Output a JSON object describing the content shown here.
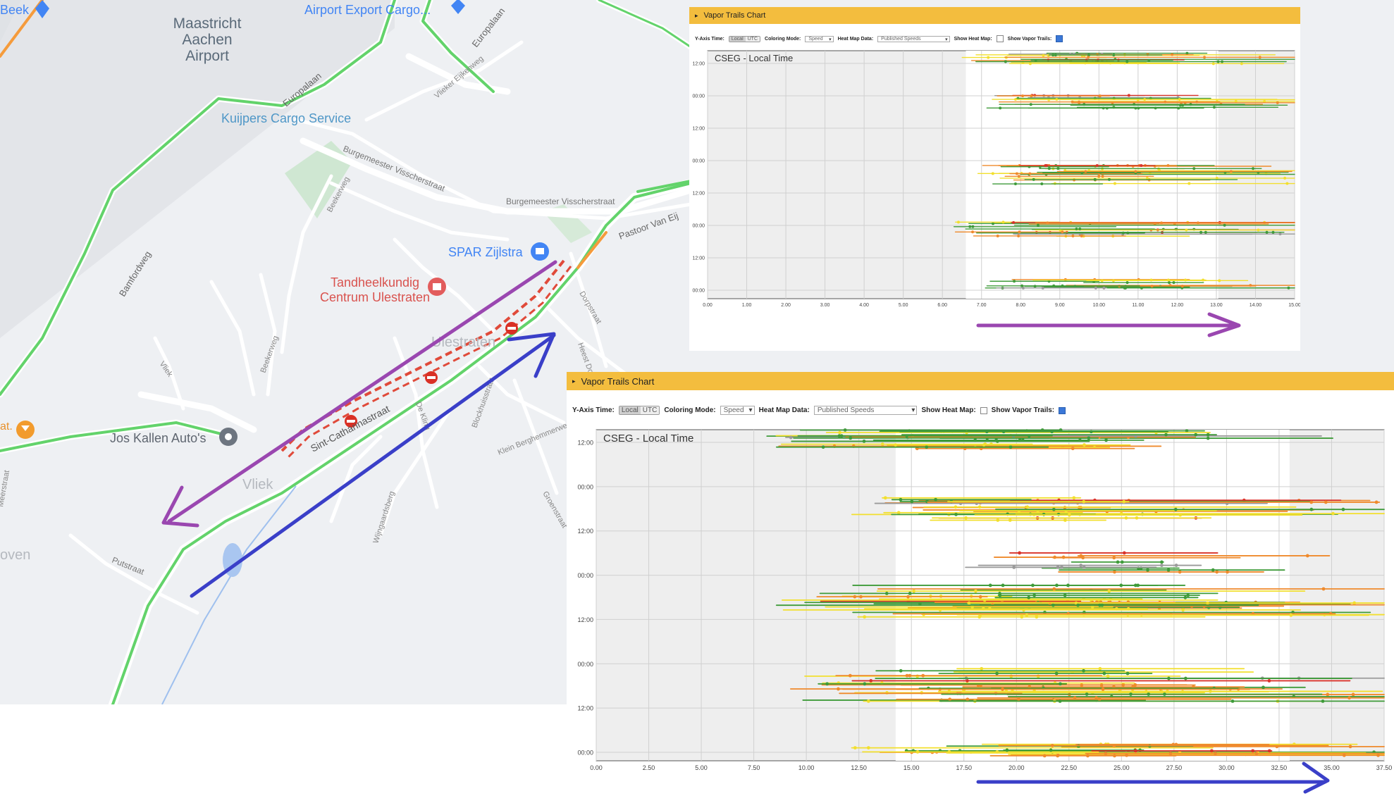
{
  "map": {
    "places": {
      "beek": "Beek",
      "airport": "Maastricht\nAachen\nAirport",
      "airport_export": "Airport Export Cargo...",
      "kuijpers": "Kuijpers Cargo Service",
      "spar": "SPAR Zijlstra",
      "tandheel": "Tandheelkundig\nCentrum Ulestraten",
      "ulestraten": "Ulestraten",
      "jos_kallen": "Jos Kallen Auto's",
      "vliek": "Vliek",
      "oven": "oven",
      "at": "at."
    },
    "roads": {
      "europalaan": "Europalaan",
      "europalaan_2": "Europalaan",
      "vliekerweg": "Vlieker Eijkenweg",
      "burgemeester1": "Burgemeester Visscherstraat",
      "burgemeester2": "Burgemeester Visscherstraat",
      "beekerweg": "Beekerweg",
      "bamfordweg": "Bamfordweg",
      "pastoor": "Pastoor Van Eij",
      "sint_catharinastraat": "Sint-Catharinastraat",
      "dorpstraat": "Dorpstraat",
      "putstraat": "Putstraat",
      "vliek_road": "Vliek",
      "beekerweg2": "Beekerweg",
      "de_kling": "De Kling",
      "blockhuisstraat": "Blockhuisstraat",
      "klein_berghemmerweg": "Klein Berghemmerweg",
      "wijngaardsberg": "Wijngaardsberg",
      "groenstraat": "Groenstraat",
      "meerstraat": "Meerstraat",
      "hessel": "Heest Do"
    },
    "colors": {
      "land": "#eef0f3",
      "airport_area": "#e3e5e9",
      "road_green": "#63d36b",
      "road_orange": "#f59b3c",
      "road_red": "#e04a3a",
      "purple_arrow": "#9a47b0",
      "blue_arrow": "#3a3fc8"
    }
  },
  "charts": [
    {
      "title": "Vapor Trails Chart",
      "controls": {
        "y_axis_time_label": "Y-Axis Time:",
        "y_axis_options": [
          "Local",
          "UTC"
        ],
        "coloring_mode_label": "Coloring Mode:",
        "coloring_mode_value": "Speed",
        "heat_map_label": "Heat Map Data:",
        "heat_map_value": "Published Speeds",
        "show_heat_map_label": "Show Heat Map:",
        "show_heat_map_checked": false,
        "show_vapor_trails_label": "Show Vapor Trails:",
        "show_vapor_trails_checked": true
      },
      "chart_data": {
        "type": "scatter",
        "title": "CSEG - Local Time",
        "y_tick_labels": [
          "12:00",
          "00:00",
          "12:00",
          "00:00",
          "12:00",
          "00:00",
          "12:00",
          "00:00"
        ],
        "x_tick_labels": [
          "0.00",
          "1.00",
          "2.00",
          "3.00",
          "4.00",
          "5.00",
          "6.00",
          "7.00",
          "8.00",
          "9.00",
          "10.00",
          "11.00",
          "12.00",
          "13.00",
          "14.00",
          "15.00"
        ],
        "x_range": [
          0,
          15
        ],
        "grid": true,
        "colors": {
          "green": "#3f9b3a",
          "yellow": "#f2df2e",
          "orange": "#ef8a2c",
          "red": "#d9342b",
          "gray": "#9a9a9a"
        }
      }
    },
    {
      "title": "Vapor Trails Chart",
      "controls": {
        "y_axis_time_label": "Y-Axis Time:",
        "y_axis_options": [
          "Local",
          "UTC"
        ],
        "coloring_mode_label": "Coloring Mode:",
        "coloring_mode_value": "Speed",
        "heat_map_label": "Heat Map Data:",
        "heat_map_value": "Published Speeds",
        "show_heat_map_label": "Show Heat Map:",
        "show_heat_map_checked": false,
        "show_vapor_trails_label": "Show Vapor Trails:",
        "show_vapor_trails_checked": true
      },
      "chart_data": {
        "type": "scatter",
        "title": "CSEG - Local Time",
        "y_tick_labels": [
          "12:00",
          "00:00",
          "12:00",
          "00:00",
          "12:00",
          "00:00",
          "12:00",
          "00:00"
        ],
        "x_tick_labels": [
          "0.00",
          "2.50",
          "5.00",
          "7.50",
          "10.00",
          "12.50",
          "15.00",
          "17.50",
          "20.00",
          "22.50",
          "25.00",
          "27.50",
          "30.00",
          "32.50",
          "35.00",
          "37.50"
        ],
        "x_range": [
          0,
          37.5
        ],
        "grid": true,
        "colors": {
          "green": "#3f9b3a",
          "yellow": "#f2df2e",
          "orange": "#ef8a2c",
          "red": "#d9342b",
          "gray": "#9a9a9a"
        }
      }
    }
  ]
}
